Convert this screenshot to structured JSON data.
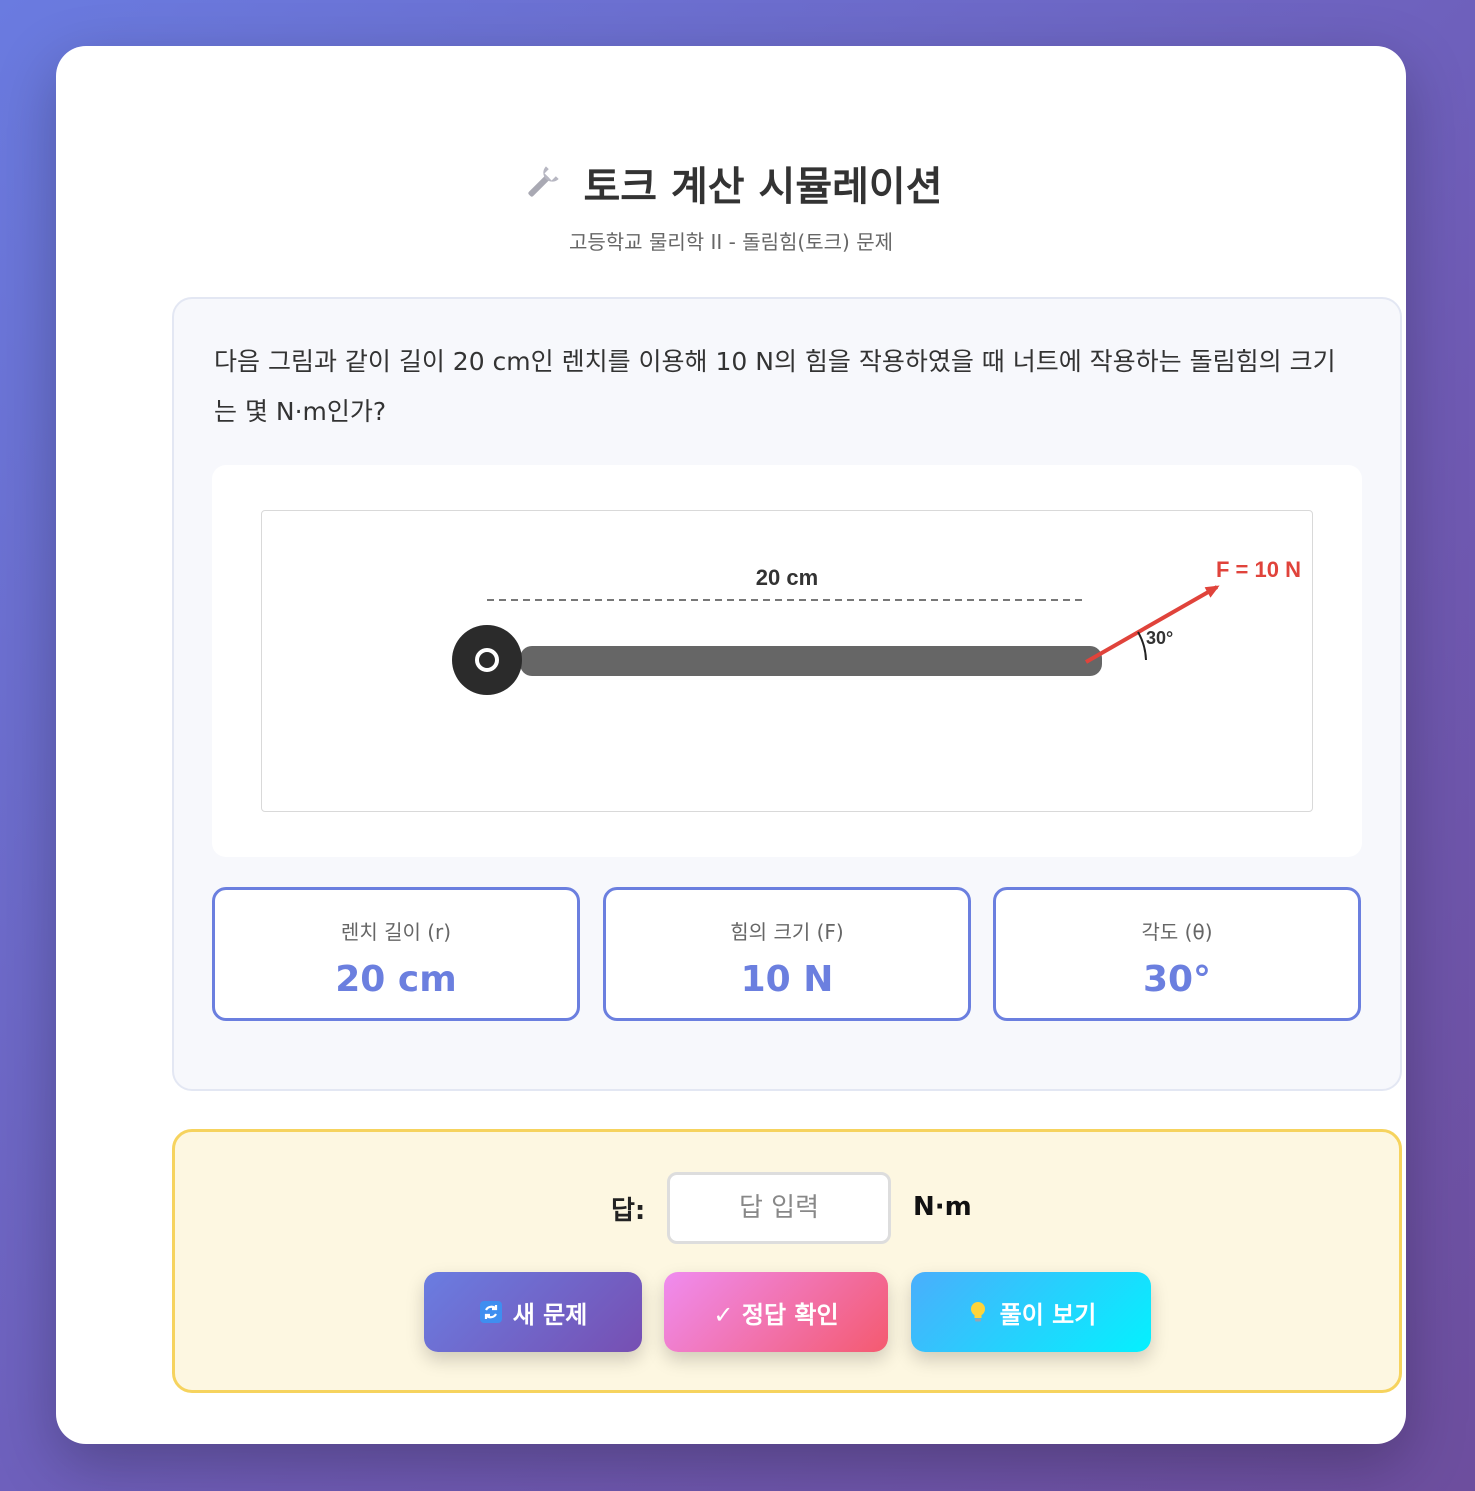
{
  "header": {
    "title": "토크 계산 시뮬레이션",
    "subtitle": "고등학교 물리학 II - 돌림힘(토크) 문제",
    "title_icon": "wrench-icon"
  },
  "problem": {
    "question": "다음 그림과 같이 길이 20 cm인 렌치를 이용해 10 N의 힘을 작용하였을 때 너트에 작용하는 돌림힘의 크기는 몇 N·m인가?",
    "diagram": {
      "length_label": "20 cm",
      "force_label": "F = 10 N",
      "angle_label": "30°",
      "angle_deg": 30,
      "colors": {
        "wrench": "#666666",
        "nut": "#2b2b2b",
        "force": "#e0433b"
      }
    },
    "values": [
      {
        "label": "렌치 길이 (r)",
        "value": "20 cm"
      },
      {
        "label": "힘의 크기 (F)",
        "value": "10 N"
      },
      {
        "label": "각도 (θ)",
        "value": "30°"
      }
    ]
  },
  "answer": {
    "label": "답:",
    "input_value": "",
    "placeholder": "답 입력",
    "unit": "N·m"
  },
  "buttons": {
    "new": {
      "icon": "refresh-icon",
      "label": "새 문제"
    },
    "check": {
      "label": "✓ 정답 확인"
    },
    "solution": {
      "icon": "lightbulb-icon",
      "label": "풀이 보기"
    }
  },
  "colors": {
    "accent": "#6b7fdf",
    "answer_bg": "#fdf7e1",
    "answer_border": "#f6d35e"
  }
}
